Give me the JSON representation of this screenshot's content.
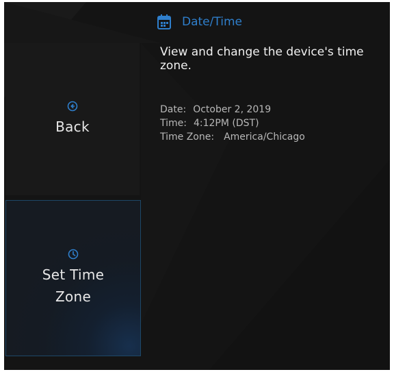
{
  "header": {
    "title": "Date/Time",
    "icon": "calendar-icon",
    "accent_color": "#2f7fcc"
  },
  "description": "View and change the device's time zone.",
  "info": {
    "date_label": "Date:",
    "date_value": "October 2, 2019",
    "time_label": "Time:",
    "time_value": "4:12PM (DST)",
    "timezone_label": "Time Zone:",
    "timezone_value": "America/Chicago"
  },
  "tiles": {
    "back": {
      "label": "Back",
      "icon": "back-arrow-circle-icon"
    },
    "set_time_zone": {
      "label_line1": "Set Time",
      "label_line2": "Zone",
      "icon": "clock-icon"
    }
  },
  "colors": {
    "background": "#141414",
    "tile_border_selected": "#1e4868",
    "text": "#e8e8e8"
  }
}
